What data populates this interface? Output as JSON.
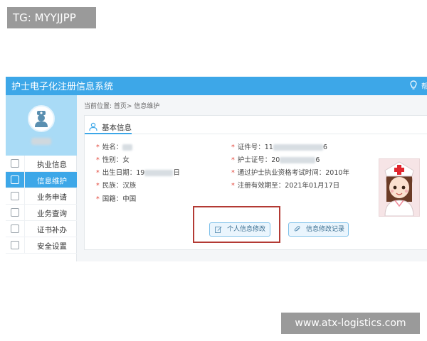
{
  "watermark": {
    "top": "TG: MYYJJPP",
    "bottom": "www.atx-logistics.com"
  },
  "header": {
    "title": "护士电子化注册信息系统",
    "trailing": "帮"
  },
  "sidebar": {
    "menu": [
      {
        "label": "执业信息",
        "icon": "headset-icon",
        "active": false
      },
      {
        "label": "信息维护",
        "icon": "photo-icon",
        "active": true
      },
      {
        "label": "业务申请",
        "icon": "edit-icon",
        "active": false
      },
      {
        "label": "业务查询",
        "icon": "globe-icon",
        "active": false
      },
      {
        "label": "证书补办",
        "icon": "document-icon",
        "active": false
      },
      {
        "label": "安全设置",
        "icon": "user-shield-icon",
        "active": false
      }
    ]
  },
  "breadcrumb": "当前位置: 首页> 信息维护",
  "card": {
    "title": "基本信息",
    "left_fields": [
      {
        "label": "姓名：",
        "pre": "",
        "post": ""
      },
      {
        "label": "性别：",
        "pre": "女",
        "post": ""
      },
      {
        "label": "出生日期：",
        "pre": "19",
        "post": "日"
      },
      {
        "label": "民族：",
        "pre": "汉族",
        "post": ""
      },
      {
        "label": "国籍：",
        "pre": "中国",
        "post": ""
      }
    ],
    "right_fields": [
      {
        "label": "证件号：",
        "pre": "11",
        "post": "6"
      },
      {
        "label": "护士证号：",
        "pre": "20",
        "post": "6"
      },
      {
        "label": "通过护士执业资格考试时间：",
        "pre": "2010年",
        "post": ""
      },
      {
        "label": "注册有效期至：",
        "pre": "2021年01月17日",
        "post": ""
      }
    ],
    "buttons": {
      "edit_info": "个人信息修改",
      "edit_history": "信息修改记录"
    }
  },
  "colors": {
    "accent": "#3da7e8",
    "highlight_box": "#b33a34",
    "required": "#e3493d"
  }
}
